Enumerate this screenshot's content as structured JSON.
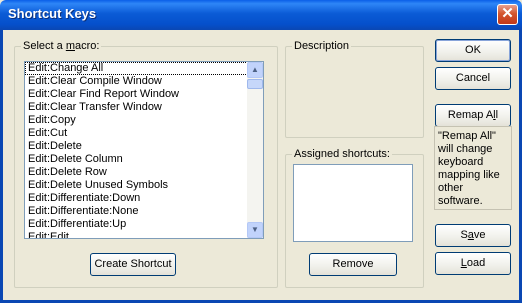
{
  "window": {
    "title": "Shortcut Keys"
  },
  "macro_group": {
    "label_before": "Select a ",
    "label_accel": "m",
    "label_after": "acro:",
    "items": [
      "Edit:Change All",
      "Edit:Clear Compile Window",
      "Edit:Clear Find Report Window",
      "Edit:Clear Transfer Window",
      "Edit:Copy",
      "Edit:Cut",
      "Edit:Delete",
      "Edit:Delete Column",
      "Edit:Delete Row",
      "Edit:Delete Unused Symbols",
      "Edit:Differentiate:Down",
      "Edit:Differentiate:None",
      "Edit:Differentiate:Up",
      "Edit:Edit"
    ],
    "selected_index": 0,
    "create_button": "Create Shortcut"
  },
  "description_group": {
    "label": "Description"
  },
  "assigned_group": {
    "label": "Assigned shortcuts:",
    "remove_button": "Remove"
  },
  "buttons": {
    "ok": "OK",
    "cancel": "Cancel",
    "remap_before": "Remap A",
    "remap_accel": "l",
    "remap_after": "l",
    "save_before": "S",
    "save_accel": "a",
    "save_after": "ve",
    "load_accel": "L",
    "load_after": "oad"
  },
  "help_text": "\"Remap All\" will change keyboard mapping like other software."
}
